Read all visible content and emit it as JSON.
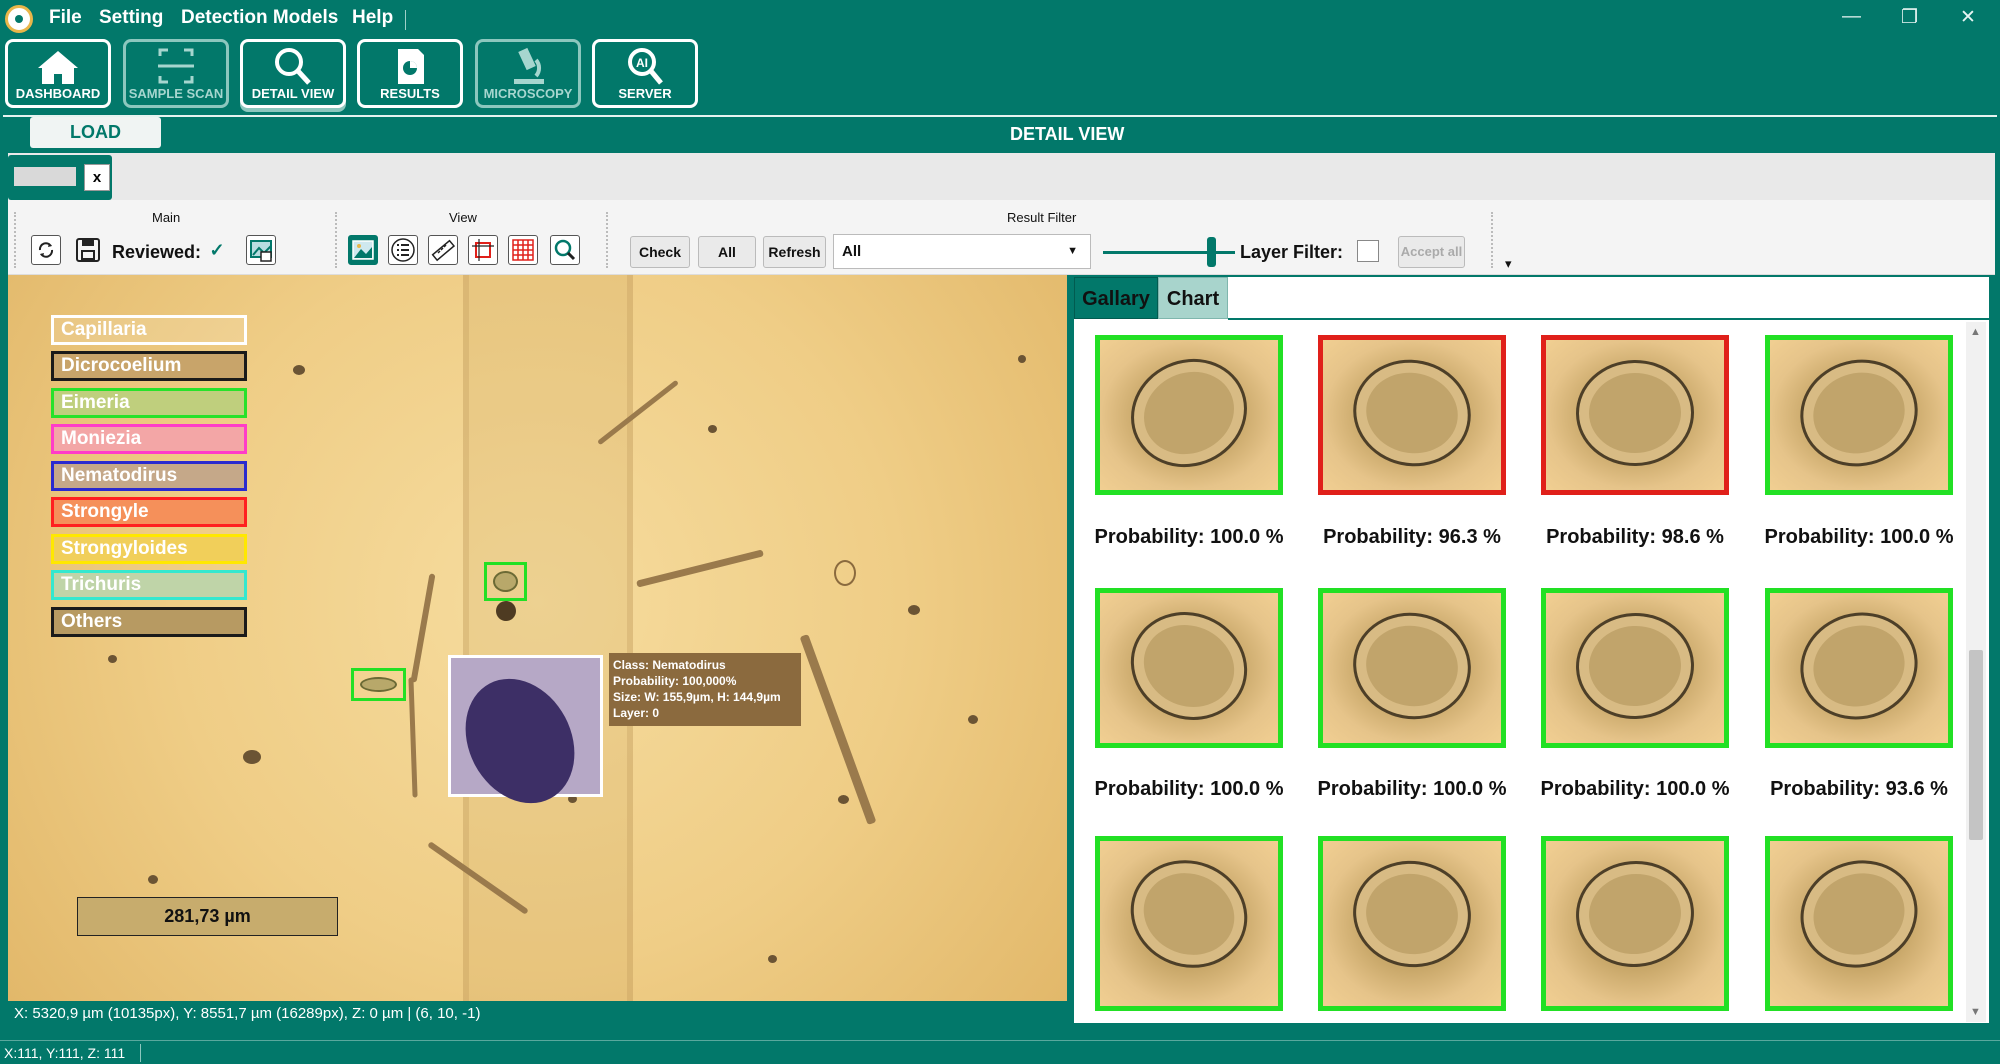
{
  "menu": {
    "items": [
      "File",
      "Setting",
      "Detection Models",
      "Help"
    ]
  },
  "window_controls": {
    "minimize": "—",
    "restore": "❐",
    "close": "✕"
  },
  "toolbar": {
    "buttons": [
      {
        "label": "DASHBOARD",
        "icon": "home-icon",
        "enabled": true
      },
      {
        "label": "SAMPLE SCAN",
        "icon": "scan-icon",
        "enabled": false
      },
      {
        "label": "DETAIL VIEW",
        "icon": "magnifier-icon",
        "enabled": true,
        "selected": true
      },
      {
        "label": "RESULTS",
        "icon": "results-document-icon",
        "enabled": true
      },
      {
        "label": "MICROSCOPY",
        "icon": "microscope-icon",
        "enabled": false
      },
      {
        "label": "SERVER",
        "icon": "ai-server-icon",
        "enabled": true
      }
    ]
  },
  "detail": {
    "load_label": "LOAD",
    "title": "DETAIL VIEW",
    "file_tab_close": "x"
  },
  "ribbon": {
    "groups": {
      "main": "Main",
      "view": "View",
      "filter": "Result Filter"
    },
    "reviewed_label": "Reviewed:",
    "reviewed_checked": true,
    "check_label": "Check",
    "all_label": "All",
    "refresh_label": "Refresh",
    "filter_value": "All",
    "layer_filter_label": "Layer Filter:",
    "layer_filter_checked": false,
    "accept_all_label": "Accept all",
    "overflow": "▾"
  },
  "legend": [
    {
      "label": "Capillaria",
      "color": "#ffffff",
      "fill": "rgba(255,255,255,0.12)"
    },
    {
      "label": "Dicrocoelium",
      "color": "#1a1a1a",
      "fill": "#c8a46a"
    },
    {
      "label": "Eimeria",
      "color": "#27e22a",
      "fill": "#bfcf7d"
    },
    {
      "label": "Moniezia",
      "color": "#ff3cc8",
      "fill": "#f3a6a6"
    },
    {
      "label": "Nematodirus",
      "color": "#2a2acf",
      "fill": "#c5a889"
    },
    {
      "label": "Strongyle",
      "color": "#ff2020",
      "fill": "#f5905a"
    },
    {
      "label": "Strongyloides",
      "color": "#ffe800",
      "fill": "#f1cf5a"
    },
    {
      "label": "Trichuris",
      "color": "#34e8cf",
      "fill": "#bfd4a8"
    },
    {
      "label": "Others",
      "color": "#1a1a1a",
      "fill": "#b79a62"
    }
  ],
  "detection_info": {
    "class": "Class: Nematodirus",
    "probability": "Probability: 100,000%",
    "size": "Size: W: 155,9µm, H: 144,9µm",
    "layer": "Layer: 0"
  },
  "scale_label": "281,73 µm",
  "coordinates": "X: 5320,9 µm (10135px), Y: 8551,7 µm (16289px), Z: 0 µm | (6, 10, -1)",
  "gallery": {
    "tabs": [
      "Gallary",
      "Chart"
    ],
    "items": [
      {
        "probability": "Probability: 100.0 %",
        "border": "#22e024"
      },
      {
        "probability": "Probability: 96.3 %",
        "border": "#e0201a"
      },
      {
        "probability": "Probability: 98.6 %",
        "border": "#e0201a"
      },
      {
        "probability": "Probability: 100.0 %",
        "border": "#22e024"
      },
      {
        "probability": "Probability: 100.0 %",
        "border": "#22e024"
      },
      {
        "probability": "Probability: 100.0 %",
        "border": "#22e024"
      },
      {
        "probability": "Probability: 100.0 %",
        "border": "#22e024"
      },
      {
        "probability": "Probability: 93.6 %",
        "border": "#22e024"
      },
      {
        "probability": "",
        "border": "#22e024"
      },
      {
        "probability": "",
        "border": "#22e024"
      },
      {
        "probability": "",
        "border": "#22e024"
      },
      {
        "probability": "",
        "border": "#22e024"
      }
    ]
  },
  "status": {
    "xyz": "X:111, Y:111, Z: 111"
  },
  "colors": {
    "brand": "#02786a",
    "accept_green": "#22e024",
    "reject_red": "#e0201a"
  }
}
